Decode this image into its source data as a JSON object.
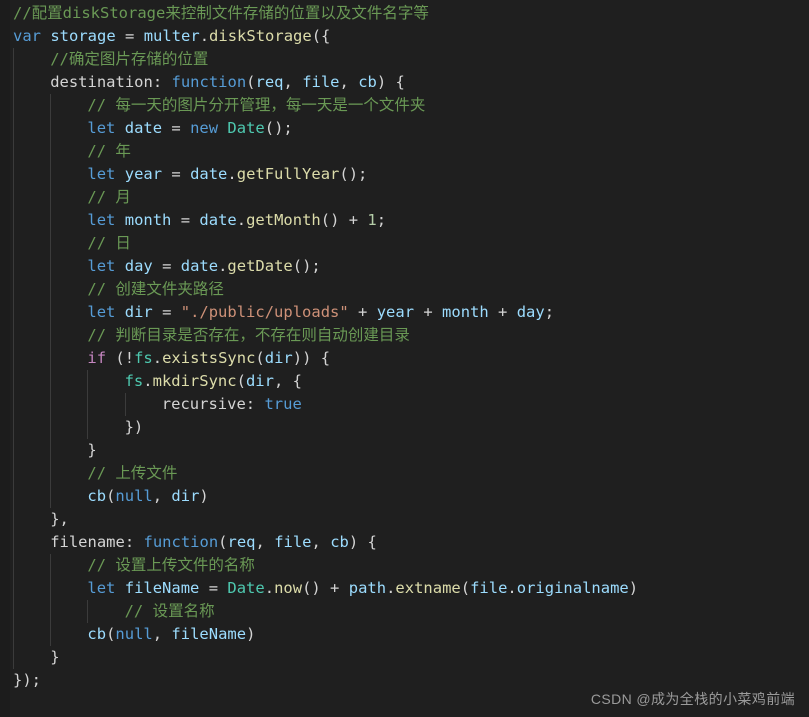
{
  "editor": {
    "background": "#1f1f1f",
    "font_size_px": 15.5,
    "line_height_px": 23,
    "colors": {
      "comment": "#6a9955",
      "keyword": "#569cd6",
      "control": "#c586c0",
      "variable": "#9cdcfe",
      "function": "#dcdcaa",
      "type": "#4ec9b0",
      "string": "#ce9178",
      "number": "#b5cea8",
      "punctuation": "#d4d4d4",
      "indent_guide": "#3b3b3b"
    }
  },
  "code": {
    "language": "javascript",
    "lines": [
      {
        "indent": 0,
        "guides": 0,
        "tokens": [
          {
            "t": "//配置diskStorage来控制文件存储的位置以及文件名字等",
            "c": "cmt"
          }
        ]
      },
      {
        "indent": 0,
        "guides": 0,
        "tokens": [
          {
            "t": "var",
            "c": "kw"
          },
          {
            "t": " ",
            "c": "pun"
          },
          {
            "t": "storage",
            "c": "var"
          },
          {
            "t": " ",
            "c": "pun"
          },
          {
            "t": "=",
            "c": "pun"
          },
          {
            "t": " ",
            "c": "pun"
          },
          {
            "t": "multer",
            "c": "var"
          },
          {
            "t": ".",
            "c": "pun"
          },
          {
            "t": "diskStorage",
            "c": "fn"
          },
          {
            "t": "({",
            "c": "pun"
          }
        ]
      },
      {
        "indent": 1,
        "guides": 1,
        "tokens": [
          {
            "t": "//确定图片存储的位置",
            "c": "cmt"
          }
        ]
      },
      {
        "indent": 1,
        "guides": 1,
        "tokens": [
          {
            "t": "destination",
            "c": "prop"
          },
          {
            "t": ": ",
            "c": "pun"
          },
          {
            "t": "function",
            "c": "kw"
          },
          {
            "t": "(",
            "c": "pun"
          },
          {
            "t": "req",
            "c": "var"
          },
          {
            "t": ", ",
            "c": "pun"
          },
          {
            "t": "file",
            "c": "var"
          },
          {
            "t": ", ",
            "c": "pun"
          },
          {
            "t": "cb",
            "c": "var"
          },
          {
            "t": ") {",
            "c": "pun"
          }
        ]
      },
      {
        "indent": 2,
        "guides": 2,
        "tokens": [
          {
            "t": "// 每一天的图片分开管理，每一天是一个文件夹",
            "c": "cmt"
          }
        ]
      },
      {
        "indent": 2,
        "guides": 2,
        "tokens": [
          {
            "t": "let",
            "c": "kw"
          },
          {
            "t": " ",
            "c": "pun"
          },
          {
            "t": "date",
            "c": "var"
          },
          {
            "t": " = ",
            "c": "pun"
          },
          {
            "t": "new",
            "c": "kw"
          },
          {
            "t": " ",
            "c": "pun"
          },
          {
            "t": "Date",
            "c": "type"
          },
          {
            "t": "();",
            "c": "pun"
          }
        ]
      },
      {
        "indent": 2,
        "guides": 2,
        "tokens": [
          {
            "t": "// 年",
            "c": "cmt"
          }
        ]
      },
      {
        "indent": 2,
        "guides": 2,
        "tokens": [
          {
            "t": "let",
            "c": "kw"
          },
          {
            "t": " ",
            "c": "pun"
          },
          {
            "t": "year",
            "c": "var"
          },
          {
            "t": " = ",
            "c": "pun"
          },
          {
            "t": "date",
            "c": "var"
          },
          {
            "t": ".",
            "c": "pun"
          },
          {
            "t": "getFullYear",
            "c": "fn"
          },
          {
            "t": "();",
            "c": "pun"
          }
        ]
      },
      {
        "indent": 2,
        "guides": 2,
        "tokens": [
          {
            "t": "// 月",
            "c": "cmt"
          }
        ]
      },
      {
        "indent": 2,
        "guides": 2,
        "tokens": [
          {
            "t": "let",
            "c": "kw"
          },
          {
            "t": " ",
            "c": "pun"
          },
          {
            "t": "month",
            "c": "var"
          },
          {
            "t": " = ",
            "c": "pun"
          },
          {
            "t": "date",
            "c": "var"
          },
          {
            "t": ".",
            "c": "pun"
          },
          {
            "t": "getMonth",
            "c": "fn"
          },
          {
            "t": "() + ",
            "c": "pun"
          },
          {
            "t": "1",
            "c": "num"
          },
          {
            "t": ";",
            "c": "pun"
          }
        ]
      },
      {
        "indent": 2,
        "guides": 2,
        "tokens": [
          {
            "t": "// 日",
            "c": "cmt"
          }
        ]
      },
      {
        "indent": 2,
        "guides": 2,
        "tokens": [
          {
            "t": "let",
            "c": "kw"
          },
          {
            "t": " ",
            "c": "pun"
          },
          {
            "t": "day",
            "c": "var"
          },
          {
            "t": " = ",
            "c": "pun"
          },
          {
            "t": "date",
            "c": "var"
          },
          {
            "t": ".",
            "c": "pun"
          },
          {
            "t": "getDate",
            "c": "fn"
          },
          {
            "t": "();",
            "c": "pun"
          }
        ]
      },
      {
        "indent": 2,
        "guides": 2,
        "tokens": [
          {
            "t": "// 创建文件夹路径",
            "c": "cmt"
          }
        ]
      },
      {
        "indent": 2,
        "guides": 2,
        "tokens": [
          {
            "t": "let",
            "c": "kw"
          },
          {
            "t": " ",
            "c": "pun"
          },
          {
            "t": "dir",
            "c": "var"
          },
          {
            "t": " = ",
            "c": "pun"
          },
          {
            "t": "\"./public/uploads\"",
            "c": "str"
          },
          {
            "t": " + ",
            "c": "pun"
          },
          {
            "t": "year",
            "c": "var"
          },
          {
            "t": " + ",
            "c": "pun"
          },
          {
            "t": "month",
            "c": "var"
          },
          {
            "t": " + ",
            "c": "pun"
          },
          {
            "t": "day",
            "c": "var"
          },
          {
            "t": ";",
            "c": "pun"
          }
        ]
      },
      {
        "indent": 2,
        "guides": 2,
        "tokens": [
          {
            "t": "// 判断目录是否存在，不存在则自动创建目录",
            "c": "cmt"
          }
        ]
      },
      {
        "indent": 2,
        "guides": 2,
        "tokens": [
          {
            "t": "if",
            "c": "ctrl"
          },
          {
            "t": " (!",
            "c": "pun"
          },
          {
            "t": "fs",
            "c": "type"
          },
          {
            "t": ".",
            "c": "pun"
          },
          {
            "t": "existsSync",
            "c": "fn"
          },
          {
            "t": "(",
            "c": "pun"
          },
          {
            "t": "dir",
            "c": "var"
          },
          {
            "t": ")) {",
            "c": "pun"
          }
        ]
      },
      {
        "indent": 3,
        "guides": 3,
        "tokens": [
          {
            "t": "fs",
            "c": "type"
          },
          {
            "t": ".",
            "c": "pun"
          },
          {
            "t": "mkdirSync",
            "c": "fn"
          },
          {
            "t": "(",
            "c": "pun"
          },
          {
            "t": "dir",
            "c": "var"
          },
          {
            "t": ", {",
            "c": "pun"
          }
        ]
      },
      {
        "indent": 4,
        "guides": 4,
        "tokens": [
          {
            "t": "recursive",
            "c": "prop"
          },
          {
            "t": ": ",
            "c": "pun"
          },
          {
            "t": "true",
            "c": "kw"
          }
        ]
      },
      {
        "indent": 3,
        "guides": 3,
        "tokens": [
          {
            "t": "})",
            "c": "pun"
          }
        ]
      },
      {
        "indent": 2,
        "guides": 2,
        "tokens": [
          {
            "t": "}",
            "c": "pun"
          }
        ]
      },
      {
        "indent": 2,
        "guides": 2,
        "tokens": [
          {
            "t": "// 上传文件",
            "c": "cmt"
          }
        ]
      },
      {
        "indent": 2,
        "guides": 2,
        "tokens": [
          {
            "t": "cb",
            "c": "var"
          },
          {
            "t": "(",
            "c": "pun"
          },
          {
            "t": "null",
            "c": "kw"
          },
          {
            "t": ", ",
            "c": "pun"
          },
          {
            "t": "dir",
            "c": "var"
          },
          {
            "t": ")",
            "c": "pun"
          }
        ]
      },
      {
        "indent": 1,
        "guides": 1,
        "tokens": [
          {
            "t": "},",
            "c": "pun"
          }
        ]
      },
      {
        "indent": 1,
        "guides": 1,
        "tokens": [
          {
            "t": "filename",
            "c": "prop"
          },
          {
            "t": ": ",
            "c": "pun"
          },
          {
            "t": "function",
            "c": "kw"
          },
          {
            "t": "(",
            "c": "pun"
          },
          {
            "t": "req",
            "c": "var"
          },
          {
            "t": ", ",
            "c": "pun"
          },
          {
            "t": "file",
            "c": "var"
          },
          {
            "t": ", ",
            "c": "pun"
          },
          {
            "t": "cb",
            "c": "var"
          },
          {
            "t": ") {",
            "c": "pun"
          }
        ]
      },
      {
        "indent": 2,
        "guides": 2,
        "tokens": [
          {
            "t": "// 设置上传文件的名称",
            "c": "cmt"
          }
        ]
      },
      {
        "indent": 2,
        "guides": 2,
        "tokens": [
          {
            "t": "let",
            "c": "kw"
          },
          {
            "t": " ",
            "c": "pun"
          },
          {
            "t": "fileName",
            "c": "var"
          },
          {
            "t": " = ",
            "c": "pun"
          },
          {
            "t": "Date",
            "c": "type"
          },
          {
            "t": ".",
            "c": "pun"
          },
          {
            "t": "now",
            "c": "fn"
          },
          {
            "t": "() + ",
            "c": "pun"
          },
          {
            "t": "path",
            "c": "var"
          },
          {
            "t": ".",
            "c": "pun"
          },
          {
            "t": "extname",
            "c": "fn"
          },
          {
            "t": "(",
            "c": "pun"
          },
          {
            "t": "file",
            "c": "var"
          },
          {
            "t": ".",
            "c": "pun"
          },
          {
            "t": "originalname",
            "c": "var"
          },
          {
            "t": ")",
            "c": "pun"
          }
        ]
      },
      {
        "indent": 3,
        "guides": 3,
        "tokens": [
          {
            "t": "// 设置名称",
            "c": "cmt"
          }
        ]
      },
      {
        "indent": 2,
        "guides": 2,
        "tokens": [
          {
            "t": "cb",
            "c": "var"
          },
          {
            "t": "(",
            "c": "pun"
          },
          {
            "t": "null",
            "c": "kw"
          },
          {
            "t": ", ",
            "c": "pun"
          },
          {
            "t": "fileName",
            "c": "var"
          },
          {
            "t": ")",
            "c": "pun"
          }
        ]
      },
      {
        "indent": 1,
        "guides": 1,
        "tokens": [
          {
            "t": "}",
            "c": "pun"
          }
        ]
      },
      {
        "indent": 0,
        "guides": 0,
        "tokens": [
          {
            "t": "});",
            "c": "pun"
          }
        ]
      }
    ]
  },
  "watermark": {
    "text": "CSDN @成为全栈的小菜鸡前端"
  }
}
